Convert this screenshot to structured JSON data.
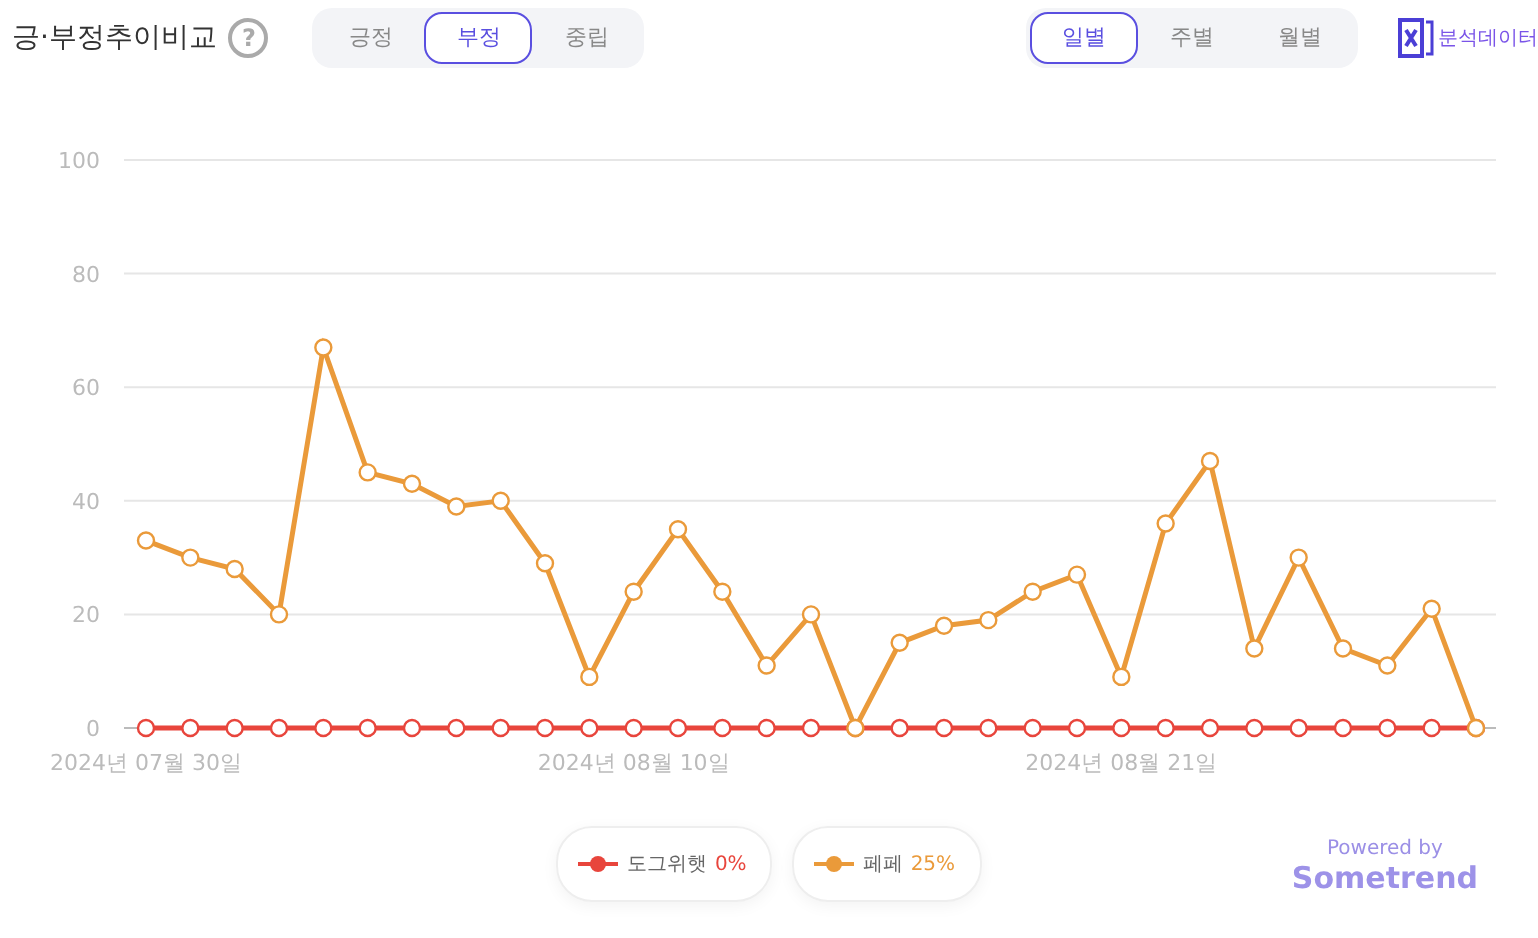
{
  "header": {
    "title": "긍·부정추이비교",
    "help": "?",
    "sentiment_tabs": [
      {
        "label": "긍정",
        "selected": false
      },
      {
        "label": "부정",
        "selected": true
      },
      {
        "label": "중립",
        "selected": false
      }
    ],
    "period_tabs": [
      {
        "label": "일별",
        "selected": true
      },
      {
        "label": "주별",
        "selected": false
      },
      {
        "label": "월별",
        "selected": false
      }
    ],
    "export_label": "분석데이터"
  },
  "chart": {
    "chart_data": {
      "type": "line",
      "ylim": [
        0,
        100
      ],
      "yticks": [
        0,
        20,
        40,
        60,
        80,
        100
      ],
      "grid": true,
      "categories": [
        "2024년 07월 30일",
        null,
        null,
        null,
        null,
        null,
        null,
        null,
        null,
        null,
        null,
        "2024년 08월 10일",
        null,
        null,
        null,
        null,
        null,
        null,
        null,
        null,
        null,
        null,
        "2024년 08월 21일",
        null,
        null,
        null,
        null,
        null,
        null,
        null,
        null
      ],
      "series": [
        {
          "name": "도그위햇",
          "color": "#e8453c",
          "marker": "circle",
          "values": [
            0,
            0,
            0,
            0,
            0,
            0,
            0,
            0,
            0,
            0,
            0,
            0,
            0,
            0,
            0,
            0,
            0,
            0,
            0,
            0,
            0,
            0,
            0,
            0,
            0,
            0,
            0,
            0,
            0,
            0,
            0
          ]
        },
        {
          "name": "페페",
          "color": "#ea9a3a",
          "marker": "circle",
          "values": [
            33,
            30,
            28,
            20,
            67,
            45,
            43,
            39,
            40,
            29,
            9,
            24,
            35,
            24,
            11,
            20,
            0,
            15,
            18,
            19,
            24,
            27,
            9,
            36,
            47,
            14,
            30,
            14,
            11,
            21,
            0
          ]
        }
      ]
    }
  },
  "legend": [
    {
      "share": "0%"
    },
    {
      "share": "25%"
    }
  ],
  "footer": {
    "powered_by": "Powered by",
    "brand": "Sometrend"
  }
}
